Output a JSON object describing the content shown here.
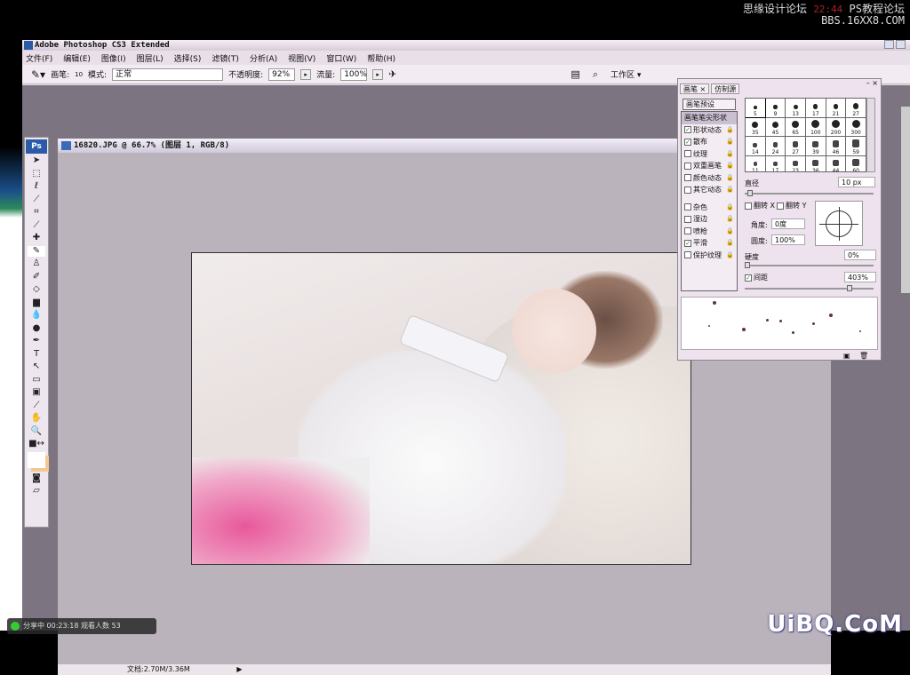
{
  "watermark_top": {
    "site_cn": "思缘设计论坛",
    "clock": "22:44",
    "forum": "PS教程论坛",
    "url": "BBS.16XX8.COM"
  },
  "window": {
    "title": "Adobe Photoshop CS3 Extended"
  },
  "menu": [
    "文件(F)",
    "编辑(E)",
    "图像(I)",
    "图层(L)",
    "选择(S)",
    "滤镜(T)",
    "分析(A)",
    "视图(V)",
    "窗口(W)",
    "帮助(H)"
  ],
  "options": {
    "brush_label": "画笔:",
    "brush_size": "10",
    "mode_label": "模式:",
    "mode_value": "正常",
    "opacity_label": "不透明度:",
    "opacity_value": "92%",
    "flow_label": "流量:",
    "flow_value": "100%",
    "workspace_label": "工作区 ▾"
  },
  "toolbox": {
    "logo": "Ps",
    "tools": [
      "move-icon",
      "marquee-icon",
      "lasso-icon",
      "quick-select-icon",
      "crop-icon",
      "slice-icon",
      "healing-icon",
      "brush-icon",
      "stamp-icon",
      "history-brush-icon",
      "eraser-icon",
      "gradient-icon",
      "blur-icon",
      "dodge-icon",
      "pen-icon",
      "type-icon",
      "path-select-icon",
      "shape-icon",
      "notes-icon",
      "eyedropper-icon",
      "hand-icon",
      "zoom-icon",
      "swap-colors-icon",
      "color-swatch-icon",
      "quick-mask-icon",
      "screen-mode-icon"
    ]
  },
  "document": {
    "title": "16820.JPG @ 66.7% (图层 1, RGB/8)",
    "status": "文档:2.70M/3.36M"
  },
  "brush_panel": {
    "tabs": [
      "画笔 ×",
      "仿制源"
    ],
    "preset_button": "画笔预设",
    "options": [
      {
        "label": "画笔笔尖形状",
        "checked": null,
        "selected": true
      },
      {
        "label": "形状动态",
        "checked": true
      },
      {
        "label": "散布",
        "checked": true
      },
      {
        "label": "纹理",
        "checked": false
      },
      {
        "label": "双重画笔",
        "checked": false
      },
      {
        "label": "颜色动态",
        "checked": false
      },
      {
        "label": "其它动态",
        "checked": false
      },
      {
        "label": "杂色",
        "checked": false
      },
      {
        "label": "湿边",
        "checked": false
      },
      {
        "label": "喷枪",
        "checked": false
      },
      {
        "label": "平滑",
        "checked": true
      },
      {
        "label": "保护纹理",
        "checked": false
      }
    ],
    "tip_sizes": [
      "5",
      "9",
      "13",
      "17",
      "21",
      "27",
      "35",
      "45",
      "65",
      "100",
      "200",
      "300",
      "14",
      "24",
      "27",
      "39",
      "46",
      "59",
      "11",
      "17",
      "23",
      "36",
      "44",
      "60"
    ],
    "diameter_label": "直径",
    "diameter_value": "10 px",
    "flip_x": "翻转 X",
    "flip_y": "翻转 Y",
    "angle_label": "角度:",
    "angle_value": "0度",
    "roundness_label": "圆度:",
    "roundness_value": "100%",
    "hardness_label": "硬度",
    "hardness_value": "0%",
    "spacing_label": "间距",
    "spacing_value": "403%",
    "spacing_checked": true,
    "spacing_fraction": 0.82
  },
  "share": {
    "status": "分享中",
    "time": "00:23:18",
    "viewers_label": "观看人数",
    "viewers": "53"
  },
  "logo": "UiBQ.CoM"
}
